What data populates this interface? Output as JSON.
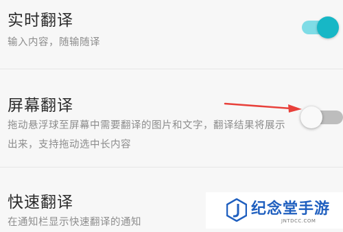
{
  "settings": {
    "items": [
      {
        "title": "实时翻译",
        "description": "输入内容，随输随译",
        "toggle_on": true
      },
      {
        "title": "屏幕翻译",
        "description": "拖动悬浮球至屏幕中需要翻译的图片和文字，翻译结果将展示出来，支持拖动选中长内容",
        "toggle_on": false
      },
      {
        "title": "快速翻译",
        "description": "在通知栏显示快速翻译的通知",
        "toggle_on": null
      }
    ]
  },
  "colors": {
    "toggle_on_knob": "#17b7c6",
    "toggle_on_track": "#7fdce6",
    "toggle_off_track": "#bdbdbd",
    "annotation_arrow": "#e8403a",
    "watermark_text": "#1f5fbf"
  },
  "annotation": {
    "arrow_icon": "red-arrow-icon"
  },
  "watermark": {
    "text": "纪念堂手游",
    "sub": "JNTDCC.COM"
  }
}
